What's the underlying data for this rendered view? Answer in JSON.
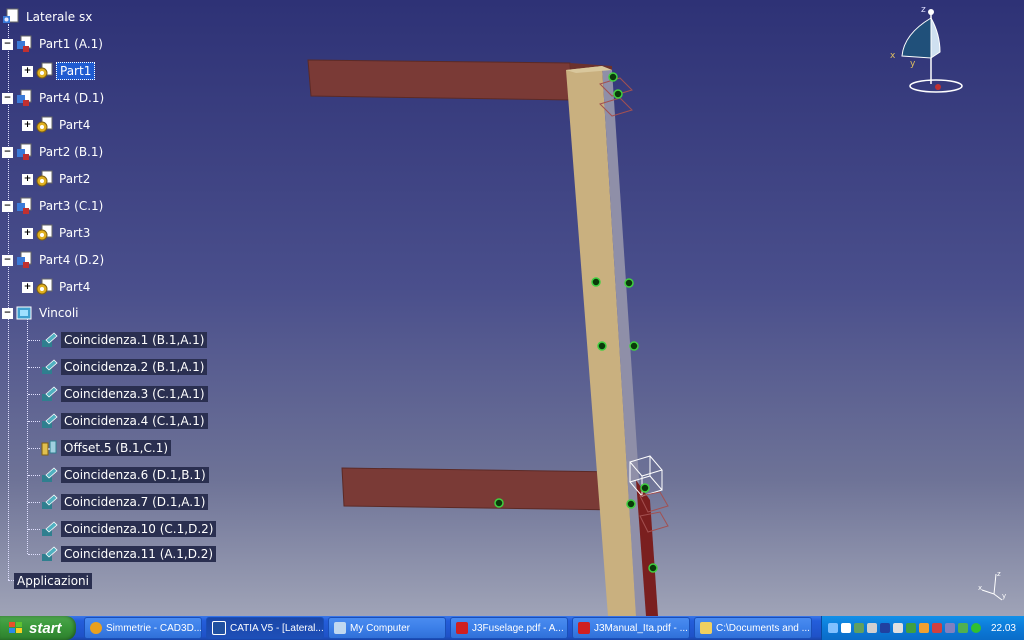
{
  "tree": {
    "root": "Laterale sx",
    "products": [
      {
        "label": "Part1 (A.1)",
        "part": "Part1",
        "selected": true
      },
      {
        "label": "Part4 (D.1)",
        "part": "Part4",
        "selected": false
      },
      {
        "label": "Part2 (B.1)",
        "part": "Part2",
        "selected": false
      },
      {
        "label": "Part3 (C.1)",
        "part": "Part3",
        "selected": false
      },
      {
        "label": "Part4 (D.2)",
        "part": "Part4",
        "selected": false
      }
    ],
    "constraints_label": "Vincoli",
    "constraints": [
      {
        "label": "Coincidenza.1 (B.1,A.1)",
        "type": "coincidence"
      },
      {
        "label": "Coincidenza.2 (B.1,A.1)",
        "type": "coincidence"
      },
      {
        "label": "Coincidenza.3 (C.1,A.1)",
        "type": "coincidence"
      },
      {
        "label": "Coincidenza.4 (C.1,A.1)",
        "type": "coincidence"
      },
      {
        "label": "Offset.5 (B.1,C.1)",
        "type": "offset"
      },
      {
        "label": "Coincidenza.6 (D.1,B.1)",
        "type": "coincidence"
      },
      {
        "label": "Coincidenza.7 (D.1,A.1)",
        "type": "coincidence"
      },
      {
        "label": "Coincidenza.10 (C.1,D.2)",
        "type": "coincidence"
      },
      {
        "label": "Coincidenza.11 (A.1,D.2)",
        "type": "coincidence"
      }
    ],
    "applications_label": "Applicazioni"
  },
  "compass": {
    "x_label": "x",
    "y_label": "y",
    "z_label": "z"
  },
  "small_axis": {
    "x_label": "x",
    "y_label": "y",
    "z_label": "z"
  },
  "taskbar": {
    "start_label": "start",
    "tasks": [
      {
        "label": "Simmetrie - CAD3D....",
        "icon": "browser-icon",
        "active": false
      },
      {
        "label": "CATIA V5 - [Lateral...",
        "icon": "catia-icon",
        "active": true
      },
      {
        "label": "My Computer",
        "icon": "computer-icon",
        "active": false
      },
      {
        "label": "J3Fuselage.pdf - A...",
        "icon": "pdf-icon",
        "active": false
      },
      {
        "label": "J3Manual_Ita.pdf - ...",
        "icon": "pdf-icon",
        "active": false
      },
      {
        "label": "C:\\Documents and ...",
        "icon": "folder-icon",
        "active": false
      }
    ],
    "clock": "22.03"
  },
  "colors": {
    "beam_red": "#7a3a36",
    "post_tan": "#c9b07f",
    "selection_blue": "#1f5bd1",
    "taskbar_blue": "#245edb",
    "start_green": "#3b9a3b"
  }
}
